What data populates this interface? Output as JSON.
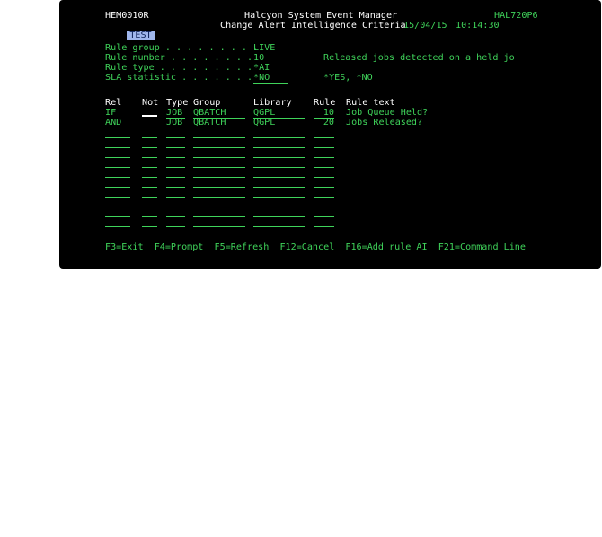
{
  "header": {
    "program": "HEM0010R",
    "env_badge": "TEST",
    "app_title": "Halcyon System Event Manager",
    "screen_title": "Change Alert Intelligence Criteria",
    "system": "HAL720P6",
    "date": "15/04/15",
    "time": "10:14:30"
  },
  "fields": {
    "rule_group": {
      "label": "Rule group . . . . . . . . .",
      "value": "LIVE"
    },
    "rule_number": {
      "label": "Rule number . . . . . . . .",
      "value": "10",
      "desc": "Released jobs detected on a held jo"
    },
    "rule_type": {
      "label": "Rule type . . . . . . . . .",
      "value": "*AI"
    },
    "sla_statistic": {
      "label": "SLA statistic . . . . . . .",
      "value": "*NO",
      "hint": "*YES, *NO"
    }
  },
  "table": {
    "headers": {
      "rel": "Rel",
      "not": "Not",
      "type": "Type",
      "group": "Group",
      "library": "Library",
      "rule": "Rule",
      "rule_text": "Rule text"
    },
    "rows": [
      {
        "rel": "IF",
        "not": "",
        "type": "JOB",
        "group": "QBATCH",
        "library": "QGPL",
        "rule": "10",
        "rule_text": "Job Queue Held?"
      },
      {
        "rel": "AND",
        "not": "",
        "type": "JOB",
        "group": "QBATCH",
        "library": "QGPL",
        "rule": "20",
        "rule_text": "Jobs Released?"
      }
    ]
  },
  "function_keys": "F3=Exit  F4=Prompt  F5=Refresh  F12=Cancel  F16=Add rule AI  F21=Command Line",
  "colors": {
    "background": "#000000",
    "text_green": "#33d04a",
    "text_white": "#ffffff",
    "badge": "#9fb6ec"
  }
}
